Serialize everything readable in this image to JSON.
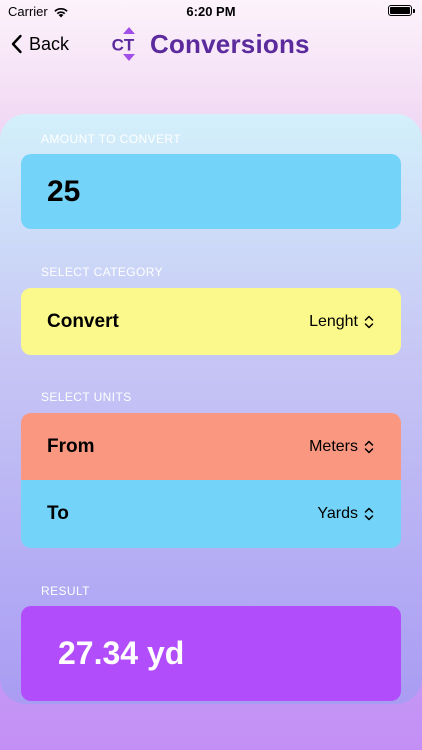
{
  "status_bar": {
    "carrier": "Carrier",
    "time": "6:20 PM"
  },
  "nav": {
    "back_label": "Back",
    "title": "Conversions"
  },
  "logo": {
    "text": "CT"
  },
  "amount": {
    "label": "AMOUNT TO CONVERT",
    "value": "25"
  },
  "category": {
    "label": "SELECT CATEGORY",
    "row_label": "Convert",
    "selected": "Lenght"
  },
  "units": {
    "label": "SELECT UNITS",
    "from_label": "From",
    "from_selected": "Meters",
    "to_label": "To",
    "to_selected": "Yards"
  },
  "result": {
    "label": "RESULT",
    "value": "27.34 yd"
  },
  "colors": {
    "accent": "#5b2a9c",
    "amount_bg": "#74d3f8",
    "category_bg": "#fbf98b",
    "from_bg": "#fa9780",
    "to_bg": "#74d3f8",
    "result_bg": "#b14dfb"
  }
}
